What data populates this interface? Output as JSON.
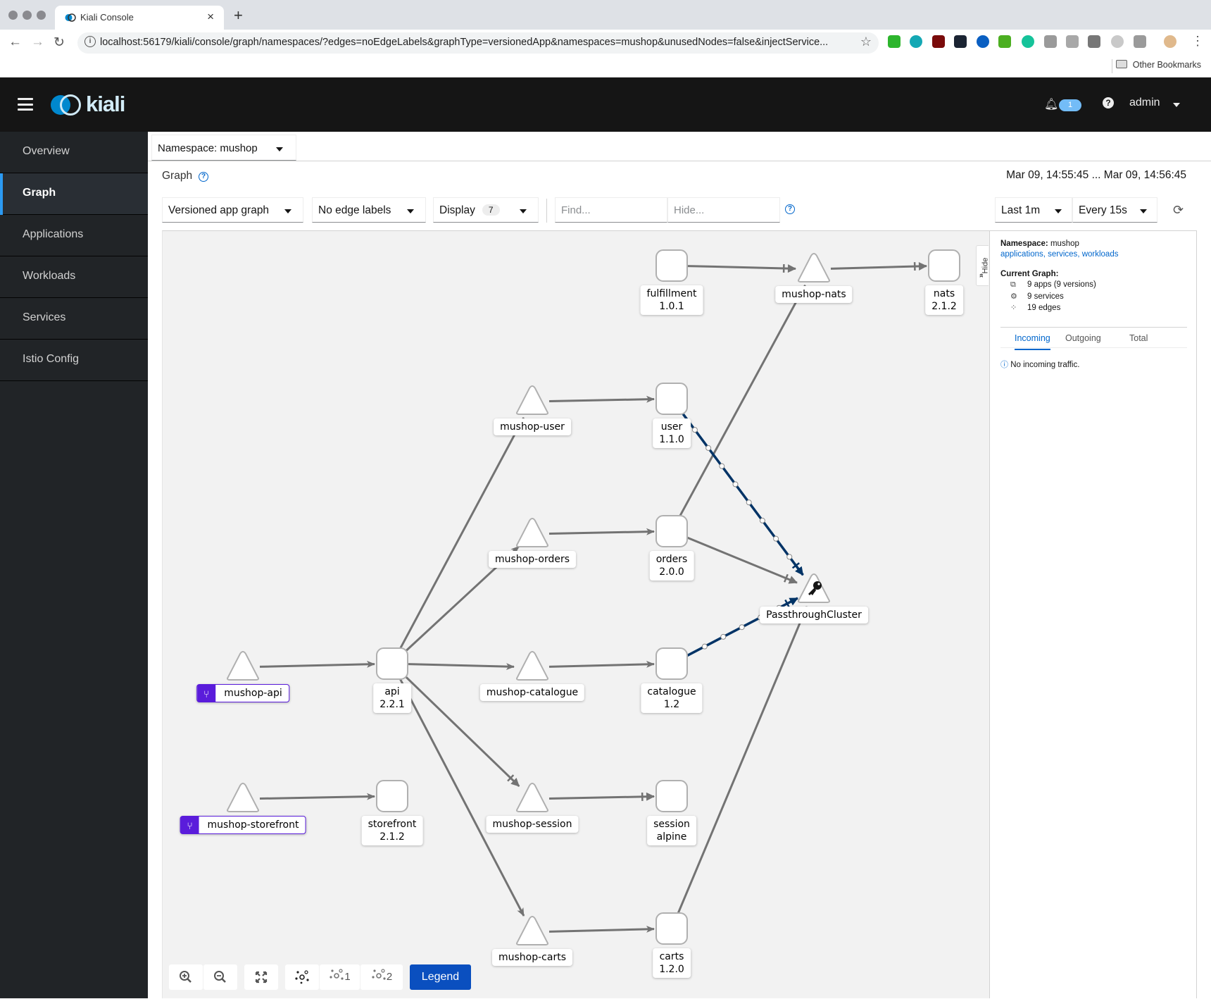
{
  "browser": {
    "tab_title": "Kiali Console",
    "new_tab": "+",
    "url": "localhost:56179/kiali/console/graph/namespaces/?edges=noEdgeLabels&graphType=versionedApp&namespaces=mushop&unusedNodes=false&injectService...",
    "bookmark_other": "Other Bookmarks",
    "extension_colors": [
      "#2db52d",
      "#14a8b4",
      "#7a0b0b",
      "#1b2433",
      "#0a5fc2",
      "#4caf21",
      "#15c39a",
      "#9a9a9a",
      "#a8a8a8",
      "#777777",
      "#c9c9c9",
      "#9a9a9a"
    ]
  },
  "header": {
    "brand": "kiali",
    "notification_count": "1",
    "help": "?",
    "user": "admin"
  },
  "sidebar": {
    "items": [
      {
        "label": "Overview",
        "active": false
      },
      {
        "label": "Graph",
        "active": true
      },
      {
        "label": "Applications",
        "active": false
      },
      {
        "label": "Workloads",
        "active": false
      },
      {
        "label": "Services",
        "active": false
      },
      {
        "label": "Istio Config",
        "active": false
      }
    ]
  },
  "namespace_selector": "Namespace: mushop",
  "page": {
    "title": "Graph",
    "time_range": "Mar 09, 14:55:45 ... Mar 09, 14:56:45"
  },
  "toolbar": {
    "graph_type": "Versioned app graph",
    "edge_labels": "No edge labels",
    "display_label": "Display",
    "display_count": "7",
    "find_placeholder": "Find...",
    "hide_placeholder": "Hide...",
    "duration": "Last 1m",
    "refresh_interval": "Every 15s"
  },
  "graph": {
    "nodes": [
      {
        "id": "fulfillment",
        "type": "app",
        "name": "fulfillment",
        "version": "1.0.1"
      },
      {
        "id": "mushop-nats",
        "type": "service",
        "name": "mushop-nats"
      },
      {
        "id": "nats",
        "type": "app",
        "name": "nats",
        "version": "2.1.2"
      },
      {
        "id": "mushop-user",
        "type": "service",
        "name": "mushop-user"
      },
      {
        "id": "user",
        "type": "app",
        "name": "user",
        "version": "1.1.0"
      },
      {
        "id": "mushop-orders",
        "type": "service",
        "name": "mushop-orders"
      },
      {
        "id": "orders",
        "type": "app",
        "name": "orders",
        "version": "2.0.0"
      },
      {
        "id": "passthrough",
        "type": "service-entry",
        "name": "PassthroughCluster"
      },
      {
        "id": "mushop-api",
        "type": "service",
        "name": "mushop-api",
        "virtual_service": true
      },
      {
        "id": "api",
        "type": "app",
        "name": "api",
        "version": "2.2.1"
      },
      {
        "id": "mushop-catalogue",
        "type": "service",
        "name": "mushop-catalogue"
      },
      {
        "id": "catalogue",
        "type": "app",
        "name": "catalogue",
        "version": "1.2"
      },
      {
        "id": "mushop-storefront",
        "type": "service",
        "name": "mushop-storefront",
        "virtual_service": true
      },
      {
        "id": "storefront",
        "type": "app",
        "name": "storefront",
        "version": "2.1.2"
      },
      {
        "id": "mushop-session",
        "type": "service",
        "name": "mushop-session"
      },
      {
        "id": "session",
        "type": "app",
        "name": "session",
        "version": "alpine"
      },
      {
        "id": "mushop-carts",
        "type": "service",
        "name": "mushop-carts"
      },
      {
        "id": "carts",
        "type": "app",
        "name": "carts",
        "version": "1.2.0"
      }
    ],
    "edges": [
      {
        "from": "fulfillment",
        "to": "mushop-nats",
        "tcp": true
      },
      {
        "from": "mushop-nats",
        "to": "nats",
        "tcp": true
      },
      {
        "from": "mushop-user",
        "to": "user"
      },
      {
        "from": "mushop-orders",
        "to": "orders"
      },
      {
        "from": "orders",
        "to": "mushop-nats"
      },
      {
        "from": "orders",
        "to": "passthrough",
        "tcp": true
      },
      {
        "from": "user",
        "to": "passthrough",
        "tcp": true,
        "animated": true
      },
      {
        "from": "catalogue",
        "to": "passthrough",
        "tcp": true,
        "animated": true
      },
      {
        "from": "carts",
        "to": "passthrough"
      },
      {
        "from": "mushop-api",
        "to": "api"
      },
      {
        "from": "api",
        "to": "mushop-user"
      },
      {
        "from": "api",
        "to": "mushop-orders"
      },
      {
        "from": "api",
        "to": "mushop-catalogue"
      },
      {
        "from": "api",
        "to": "mushop-session",
        "tcp": true
      },
      {
        "from": "api",
        "to": "mushop-carts"
      },
      {
        "from": "mushop-catalogue",
        "to": "catalogue"
      },
      {
        "from": "mushop-storefront",
        "to": "storefront"
      },
      {
        "from": "mushop-session",
        "to": "session",
        "tcp": true
      },
      {
        "from": "mushop-carts",
        "to": "carts"
      }
    ],
    "edge_color": "#737373",
    "animated_edge_color": "#003366",
    "virtual_service_color": "#5a1cdb"
  },
  "graph_toolbar": {
    "zoom_in": "zoom-in",
    "zoom_out": "zoom-out",
    "fit": "fit",
    "layout_default": "",
    "layout_1": "1",
    "layout_2": "2",
    "legend": "Legend"
  },
  "side_panel": {
    "hide_label": "Hide",
    "namespace_label": "Namespace:",
    "namespace_value": "mushop",
    "links": [
      "applications",
      "services",
      "workloads"
    ],
    "current_graph_label": "Current Graph:",
    "apps": "9 apps (9 versions)",
    "services": "9 services",
    "edges": "19 edges",
    "tabs": [
      "Incoming",
      "Outgoing",
      "Total"
    ],
    "active_tab": "Incoming",
    "message": "No incoming traffic."
  }
}
